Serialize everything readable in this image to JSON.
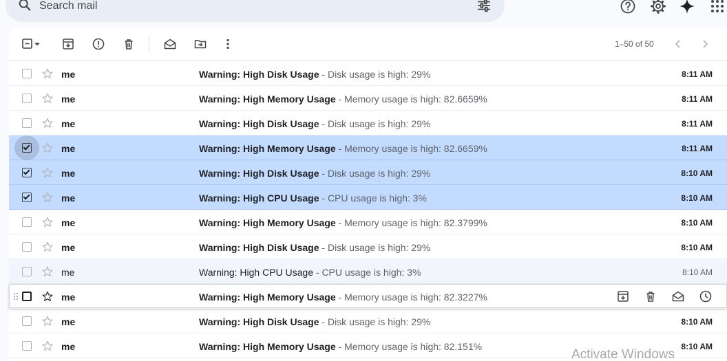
{
  "search": {
    "placeholder": "Search mail",
    "icon": "search-icon",
    "options_icon": "tune-icon"
  },
  "header_icons": [
    "help-icon",
    "settings-icon",
    "gemini-icon",
    "apps-icon"
  ],
  "toolbar": {
    "icons": [
      "select-checkbox-icon",
      "dropdown-icon",
      "archive-icon",
      "report-spam-icon",
      "delete-icon",
      "mark-read-icon",
      "move-to-icon",
      "more-icon"
    ],
    "pagination": "1–50 of 50"
  },
  "emails": [
    {
      "sender": "me",
      "subject": "Warning: High Disk Usage",
      "snippet": " - Disk usage is high: 29%",
      "time": "8:11 AM",
      "selected": false,
      "read": false
    },
    {
      "sender": "me",
      "subject": "Warning: High Memory Usage",
      "snippet": " - Memory usage is high: 82.6659%",
      "time": "8:11 AM",
      "selected": false,
      "read": false
    },
    {
      "sender": "me",
      "subject": "Warning: High Disk Usage",
      "snippet": " - Disk usage is high: 29%",
      "time": "8:11 AM",
      "selected": false,
      "read": false
    },
    {
      "sender": "me",
      "subject": "Warning: High Memory Usage",
      "snippet": " - Memory usage is high: 82.6659%",
      "time": "8:11 AM",
      "selected": true,
      "read": false
    },
    {
      "sender": "me",
      "subject": "Warning: High Disk Usage",
      "snippet": " - Disk usage is high: 29%",
      "time": "8:10 AM",
      "selected": true,
      "read": false
    },
    {
      "sender": "me",
      "subject": "Warning: High CPU Usage",
      "snippet": " - CPU usage is high: 3%",
      "time": "8:10 AM",
      "selected": true,
      "read": false
    },
    {
      "sender": "me",
      "subject": "Warning: High Memory Usage",
      "snippet": " - Memory usage is high: 82.3799%",
      "time": "8:10 AM",
      "selected": false,
      "read": false
    },
    {
      "sender": "me",
      "subject": "Warning: High Disk Usage",
      "snippet": " - Disk usage is high: 29%",
      "time": "8:10 AM",
      "selected": false,
      "read": false
    },
    {
      "sender": "me",
      "subject": "Warning: High CPU Usage",
      "snippet": " - CPU usage is high: 3%",
      "time": "8:10 AM",
      "selected": false,
      "read": true
    },
    {
      "sender": "me",
      "subject": "Warning: High Memory Usage",
      "snippet": " - Memory usage is high: 82.3227%",
      "time": "",
      "selected": false,
      "read": false,
      "hovered": true
    },
    {
      "sender": "me",
      "subject": "Warning: High Disk Usage",
      "snippet": " - Disk usage is high: 29%",
      "time": "8:10 AM",
      "selected": false,
      "read": false
    },
    {
      "sender": "me",
      "subject": "Warning: High Memory Usage",
      "snippet": " - Memory usage is high: 82.151%",
      "time": "8:10 AM",
      "selected": false,
      "read": false
    }
  ],
  "hover_actions": [
    "archive-icon",
    "delete-icon",
    "mark-read-icon",
    "snooze-icon"
  ],
  "watermark": "Activate Windows",
  "colors": {
    "selected_row": "#c2dbff",
    "search_bg": "#e9eef6",
    "read_row": "#f2f6fc"
  }
}
